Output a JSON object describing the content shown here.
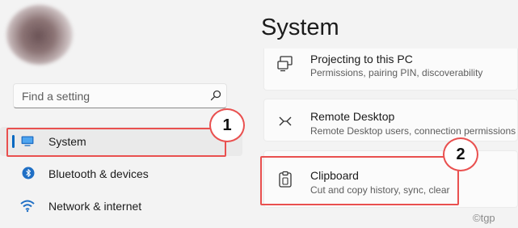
{
  "sidebar": {
    "search": {
      "placeholder": "Find a setting"
    },
    "items": [
      {
        "label": "System",
        "icon": "system-display-icon"
      },
      {
        "label": "Bluetooth & devices",
        "icon": "bluetooth-icon"
      },
      {
        "label": "Network & internet",
        "icon": "wifi-icon"
      }
    ]
  },
  "main": {
    "title": "System",
    "cards": [
      {
        "title": "Projecting to this PC",
        "subtitle": "Permissions, pairing PIN, discoverability",
        "icon": "projecting-icon"
      },
      {
        "title": "Remote Desktop",
        "subtitle": "Remote Desktop users, connection permissions",
        "icon": "remote-desktop-icon"
      },
      {
        "title": "Clipboard",
        "subtitle": "Cut and copy history, sync, clear",
        "icon": "clipboard-icon"
      }
    ]
  },
  "annotations": {
    "step1": "1",
    "step2": "2",
    "highlight_color": "#e9504f"
  },
  "watermark": "©tgp",
  "colors": {
    "accent": "#0067c0",
    "background": "#f3f3f3",
    "card": "#fbfbfb"
  }
}
